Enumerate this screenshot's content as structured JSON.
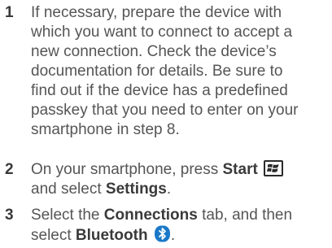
{
  "steps": [
    {
      "number": "1",
      "lines": [
        "If necessary, prepare the device with",
        "which you want to connect to accept a",
        "new connection. Check the device’s",
        "documentation for details. Be sure to",
        "find out if the device has a predefined",
        "passkey that you need to enter on your",
        "smartphone in step 8."
      ]
    },
    {
      "number": "2",
      "line1_prefix": "On your smartphone, press ",
      "line1_bold": "Start",
      "line2_prefix": "and select ",
      "line2_bold": "Settings",
      "line2_suffix": "."
    },
    {
      "number": "3",
      "line1_prefix": "Select the ",
      "line1_bold": "Connections",
      "line1_suffix": " tab, and then",
      "line2_prefix": "select ",
      "line2_bold": "Bluetooth",
      "line2_suffix": "."
    }
  ],
  "icons": {
    "start": "windows-start-icon",
    "bluetooth": "bluetooth-icon",
    "bluetooth_color": "#1a78c8"
  }
}
